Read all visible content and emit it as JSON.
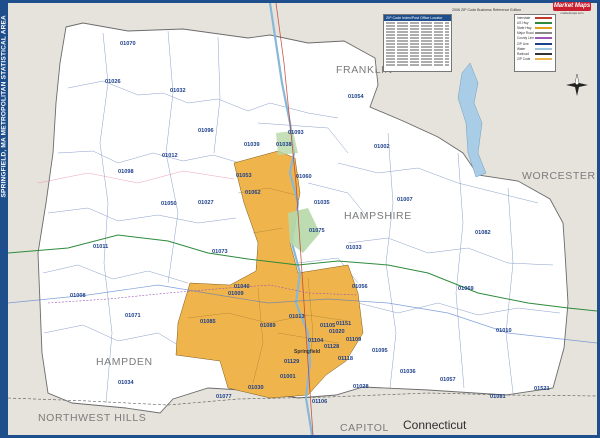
{
  "map": {
    "title": "SPRINGFIELD, MA METROPOLITAN STATISTICAL AREA",
    "edition": "2006 ZIP Code Business Reference Edition",
    "publisher_logo": "Market Maps",
    "publisher_sub": "marketmaps.com",
    "legend_header": "ZIP Code Index/Post Office Locator",
    "regions": {
      "franklin": "FRANKLIN",
      "worcester": "WORCESTER",
      "hampshire": "HAMPSHIRE",
      "hampden": "HAMPDEN",
      "northwest_hills": "NORTHWEST HILLS",
      "capitol": "CAPITOL",
      "connecticut": "Connecticut"
    },
    "city_label": "Springfield",
    "key_items": [
      {
        "label": "Interstate",
        "color": "#c0392b"
      },
      {
        "label": "US Hwy",
        "color": "#2e8b3c"
      },
      {
        "label": "State Hwy",
        "color": "#e3a21a"
      },
      {
        "label": "Major Road",
        "color": "#888888"
      },
      {
        "label": "County Line",
        "color": "#9b59b6"
      },
      {
        "label": "ZIP Line",
        "color": "#1c3f8a"
      },
      {
        "label": "Water",
        "color": "#9fc6e0"
      },
      {
        "label": "Railroad",
        "color": "#333333"
      },
      {
        "label": "ZIP Code",
        "color": "#f0b44c"
      }
    ],
    "zips": [
      "01070",
      "01026",
      "01032",
      "01096",
      "01039",
      "01038",
      "01054",
      "01093",
      "01012",
      "01002",
      "01098",
      "01053",
      "01062",
      "01060",
      "01035",
      "01007",
      "01050",
      "01027",
      "01073",
      "01075",
      "01011",
      "01033",
      "01082",
      "01009",
      "01085",
      "01040",
      "01056",
      "01069",
      "01071",
      "01008",
      "01010",
      "01089",
      "01013",
      "01020",
      "01095",
      "01034",
      "01030",
      "01001",
      "01028",
      "01036",
      "01057",
      "01106",
      "01077",
      "01081",
      "01521",
      "01151",
      "01118",
      "01104",
      "01105",
      "01109",
      "01128",
      "01129"
    ]
  }
}
